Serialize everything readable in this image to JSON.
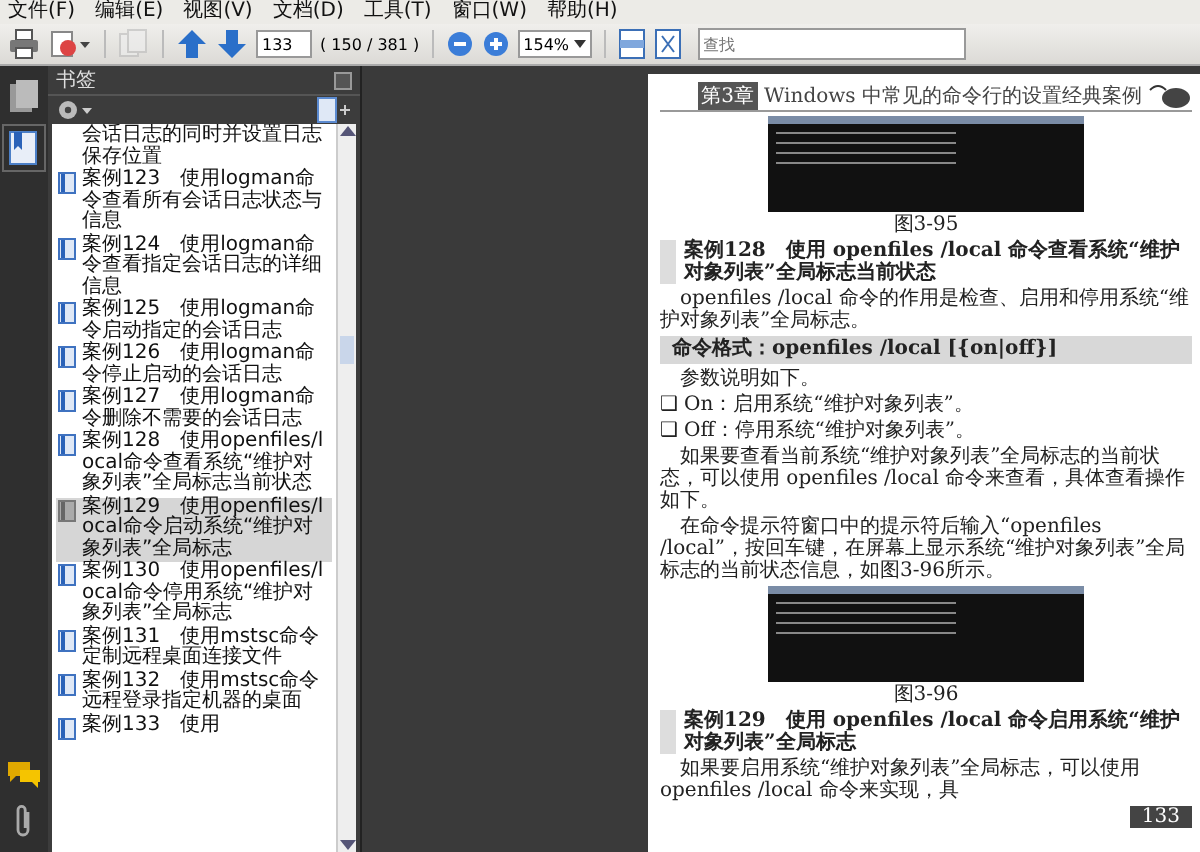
{
  "menu": [
    "文件(F)",
    "编辑(E)",
    "视图(V)",
    "文档(D)",
    "工具(T)",
    "窗口(W)",
    "帮助(H)"
  ],
  "toolbar": {
    "page_field": "133",
    "page_count": "( 150 / 381 )",
    "zoom": "154%",
    "search": {
      "placeholder": "查找"
    }
  },
  "bookmarks_panel": {
    "title": "书签",
    "items": [
      {
        "kind": "continuation",
        "label": "会话日志的同时并设置日志保存位置",
        "selected": false
      },
      {
        "kind": "bookmark",
        "label": "案例123　使用logman命令查看所有会话日志状态与信息",
        "selected": false
      },
      {
        "kind": "bookmark",
        "label": "案例124　使用logman命令查看指定会话日志的详细信息",
        "selected": false
      },
      {
        "kind": "bookmark",
        "label": "案例125　使用logman命令启动指定的会话日志",
        "selected": false
      },
      {
        "kind": "bookmark",
        "label": "案例126　使用logman命令停止启动的会话日志",
        "selected": false
      },
      {
        "kind": "bookmark",
        "label": "案例127　使用logman命令删除不需要的会话日志",
        "selected": false
      },
      {
        "kind": "bookmark",
        "label": "案例128　使用openfiles/local命令查看系统“维护对象列表”全局标志当前状态",
        "selected": false
      },
      {
        "kind": "bookmark",
        "label": "案例129　使用openfiles/local命令启动系统“维护对象列表”全局标志",
        "selected": true
      },
      {
        "kind": "bookmark",
        "label": "案例130　使用openfiles/local命令停用系统“维护对象列表”全局标志",
        "selected": false
      },
      {
        "kind": "bookmark",
        "label": "案例131　使用mstsc命令定制远程桌面连接文件",
        "selected": false
      },
      {
        "kind": "bookmark",
        "label": "案例132　使用mstsc命令远程登录指定机器的桌面",
        "selected": false
      },
      {
        "kind": "bookmark",
        "label": "案例133　使用",
        "selected": false
      }
    ]
  },
  "document_page": {
    "chapter_tag": "第3章",
    "running_head": "Windows 中常见的命令行的设置经典案例",
    "blocks": [
      {
        "kind": "figure",
        "caption": "图3-95"
      },
      {
        "kind": "heading",
        "text": "案例128　使用 openfiles /local 命令查看系统“维护对象列表”全局标志当前状态"
      },
      {
        "kind": "paragraph",
        "text": "openfiles /local 命令的作用是检查、启用和停用系统“维护对象列表”全局标志。"
      },
      {
        "kind": "command",
        "text": "命令格式：openfiles /local [{on|off}]"
      },
      {
        "kind": "paragraph",
        "text": "参数说明如下。"
      },
      {
        "kind": "bullet",
        "marker": "❑",
        "text": "On：启用系统“维护对象列表”。"
      },
      {
        "kind": "bullet",
        "marker": "❑",
        "text": "Off：停用系统“维护对象列表”。"
      },
      {
        "kind": "paragraph",
        "text": "如果要查看当前系统“维护对象列表”全局标志的当前状态，可以使用 openfiles /local 命令来查看，具体查看操作如下。"
      },
      {
        "kind": "paragraph",
        "text": "在命令提示符窗口中的提示符后输入“openfiles /local”，按回车键，在屏幕上显示系统“维护对象列表”全局标志的当前状态信息，如图3-96所示。"
      },
      {
        "kind": "figure",
        "caption": "图3-96"
      },
      {
        "kind": "heading",
        "text": "案例129　使用 openfiles /local 命令启用系统“维护对象列表”全局标志"
      },
      {
        "kind": "paragraph",
        "text": "如果要启用系统“维护对象列表”全局标志，可以使用 openfiles /local 命令来实现，具"
      }
    ],
    "page_number": "133"
  }
}
